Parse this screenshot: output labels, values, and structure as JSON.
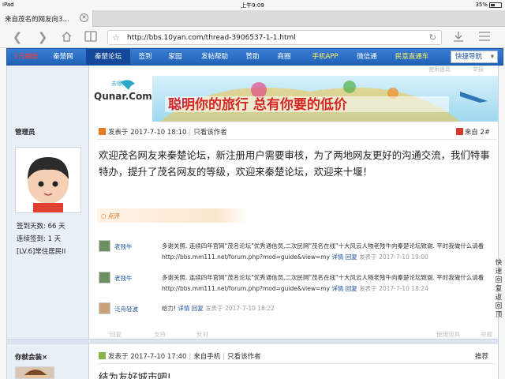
{
  "status_bar": {
    "device": "iPad",
    "time": "上午9:09",
    "battery": "35%"
  },
  "browser": {
    "tab_title": "来自茂名的网友向3...",
    "url": "http://bbs.10yan.com/thread-3906537-1-1.html"
  },
  "forum_nav": {
    "items": [
      "1元捕鱼",
      "秦楚网",
      "秦楚论坛",
      "签到",
      "家园",
      "发帖帮助",
      "赞助",
      "商圈",
      "手机APP",
      "微信通",
      "民意直通车"
    ],
    "active_index": 2,
    "quick_nav": "快捷导航"
  },
  "top_fade": {
    "tools": "使用道具",
    "report": "举报"
  },
  "banner": {
    "brand": "Qunar.Com",
    "brand_cn": "去哪儿",
    "slogan": "聪明你的旅行 总有你要的低价"
  },
  "post1": {
    "user": "管理员",
    "stats": [
      "签到天数: 66 天",
      "连续签到: 1 天",
      "[LV.6]常住居民II"
    ],
    "posted": "发表于 2017-7-10 18:10",
    "only_author": "只看该作者",
    "floor_source": "来自",
    "floor": "2#",
    "body": "欢迎茂名网友来秦楚论坛，新注册用户需要审核，为了两地网友更好的沟通交流，我们特事特办，提升了茂名网友的等级，欢迎来秦楚论坛，欢迎来十堰！",
    "comment_label": "点评",
    "comments": [
      {
        "name": "老残牛",
        "text": "多谢关照. 连续四年官网\"茂名论坛\"优秀通信员,二次民网\"茂名在线\"十大风云人物老残牛向秦楚论坛致谢. 平时我做什么请看 http://bbs.mm111.net/forum.php?mod=guide&view=my",
        "detail": "详情",
        "reply": "回复",
        "time": "发表于 2017-7-10 19:00"
      },
      {
        "name": "老残牛",
        "text": "多谢关照. 连续四年官网\"茂名论坛\"优秀通信员,二次民网\"茂名在线\"十大风云人物老残牛向秦楚论坛致谢. 平时我做什么请看 http://bbs.mm111.net/forum.php?mod=guide&view=my",
        "detail": "详情",
        "reply": "回复",
        "time": "发表于 2017-7-10 18:24"
      },
      {
        "name": "泛舟轻波",
        "text": "给力!",
        "detail": "详情",
        "reply": "回复",
        "time": "发表于 2017-7-10 18:22"
      }
    ],
    "actions": {
      "reply": "回复",
      "support": "支持",
      "oppose": "反对",
      "tools": "使用道具",
      "report": "举报"
    }
  },
  "post2": {
    "user": "你就会装×",
    "posted": "发表于 2017-7-10 17:40",
    "source": "来自手机",
    "only_author": "只看该作者",
    "recommend": "推荐",
    "body": "结为友好城市吧!"
  },
  "quick_reply": "快速回复返回顶",
  "colors": {
    "nav_blue": "#2a6dc8",
    "nav_active": "#13489a",
    "accent_orange": "#e87a1f",
    "link_blue": "#1f4f9c",
    "first_nav_item": "#ff3b2f",
    "app_yellow": "#fff25a"
  }
}
